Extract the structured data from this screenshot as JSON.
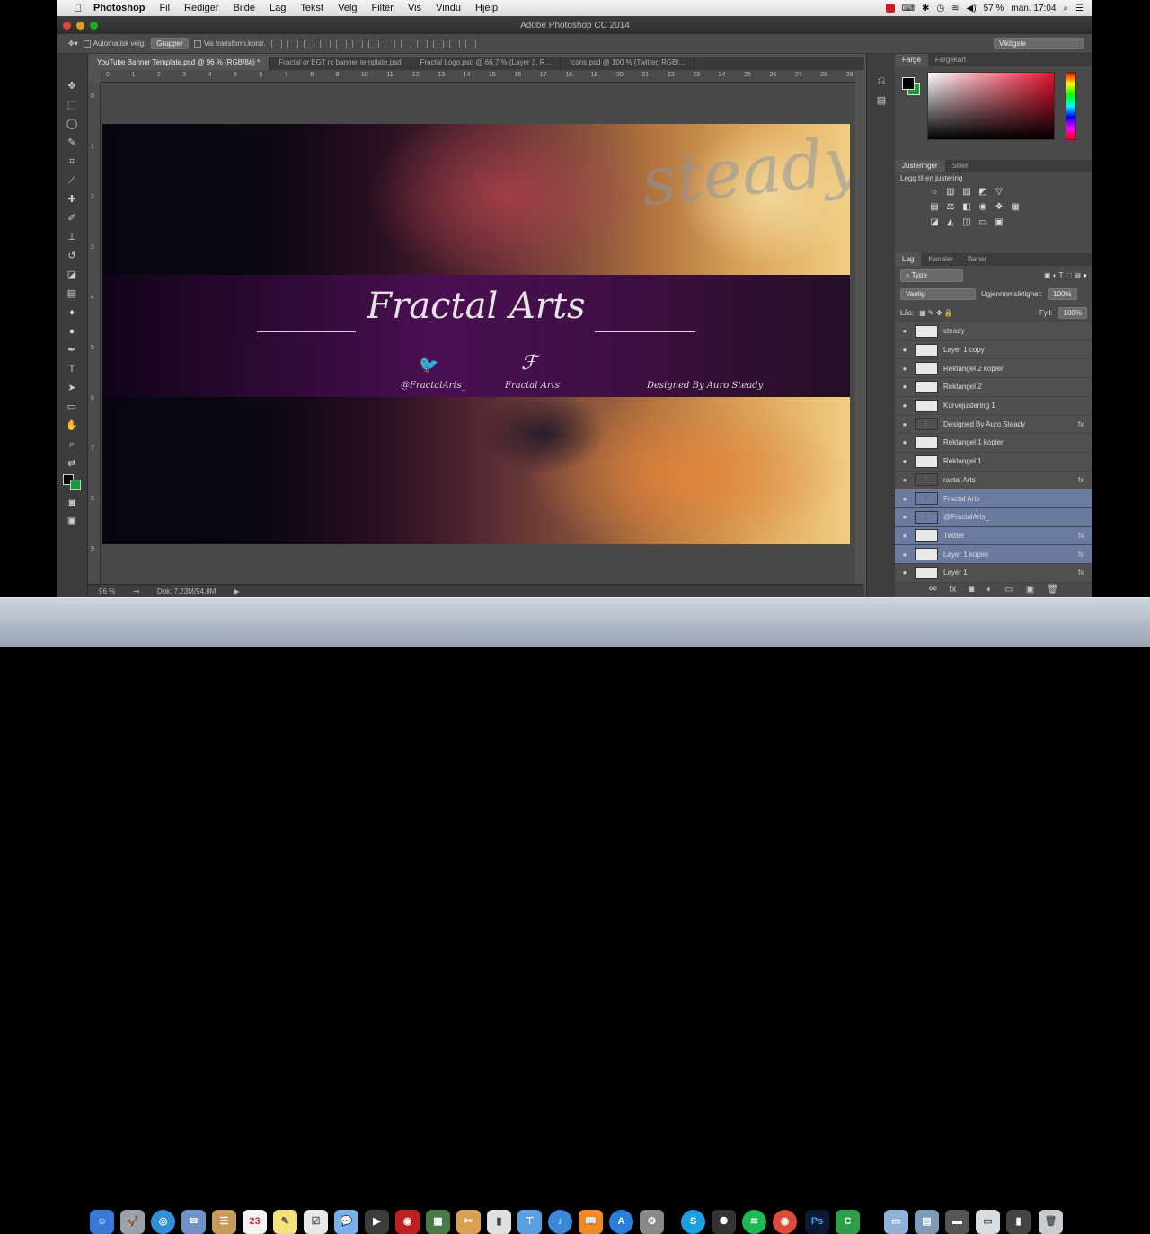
{
  "menubar": {
    "apple": "",
    "app": "Photoshop",
    "items": [
      "Fil",
      "Rediger",
      "Bilde",
      "Lag",
      "Tekst",
      "Velg",
      "Filter",
      "Vis",
      "Vindu",
      "Hjelp"
    ],
    "battery": "57 %",
    "clock": "man. 17:04"
  },
  "window": {
    "title": "Adobe Photoshop CC 2014"
  },
  "options": {
    "auto_select": "Automatisk velg:",
    "group": "Grupper",
    "show_transform": "Vis transform.kontr.",
    "workspace": "Viktigste"
  },
  "doc_tabs": [
    "YouTube Banner Template.psd @ 96 % (RGB/8#) *",
    "Fractal or EGT rc banner template.psd",
    "Fractal Logo.psd @ 66,7 % (Layer 3, R...",
    "Icons.psd @ 100 % (Twitter, RGB/..."
  ],
  "ruler_h": [
    "0",
    "1",
    "2",
    "3",
    "4",
    "5",
    "6",
    "7",
    "8",
    "9",
    "10",
    "11",
    "12",
    "13",
    "14",
    "15",
    "16",
    "17",
    "18",
    "19",
    "20",
    "21",
    "22",
    "23",
    "24",
    "25",
    "26",
    "27",
    "28",
    "29"
  ],
  "ruler_v": [
    "0",
    "1",
    "2",
    "3",
    "4",
    "5",
    "6",
    "7",
    "8",
    "9"
  ],
  "banner": {
    "bg_text": "steady",
    "title": "Fractal Arts",
    "handle": "@FractalArts_",
    "brand": "Fractal Arts",
    "designer": "Designed By Auro Steady",
    "twitter_glyph": "🐦",
    "logo_mark": "ℱ"
  },
  "status": {
    "zoom": "96 %",
    "doc": "Dok: 7,23M/94,8M"
  },
  "panels": {
    "color_tabs": [
      "Farge",
      "Fargekart"
    ],
    "adj_tabs": [
      "Justeringer",
      "Stiler"
    ],
    "adj_title": "Legg til en justering",
    "layer_tabs": [
      "Lag",
      "Kanaler",
      "Baner"
    ],
    "filter": "Type",
    "blend": "Vanlig",
    "opacity_label": "Ugjennomsiktighet:",
    "opacity_value": "100%",
    "lock_label": "Lås:",
    "fill_label": "Fyll:",
    "fill_value": "100%"
  },
  "layers": [
    {
      "name": "steady",
      "thumb": "",
      "fx": "",
      "sel": false
    },
    {
      "name": "Layer 1 copy",
      "thumb": "",
      "fx": "",
      "sel": false
    },
    {
      "name": "Rektangel 2 kopier",
      "thumb": "",
      "fx": "",
      "sel": false
    },
    {
      "name": "Rektangel 2",
      "thumb": "",
      "fx": "",
      "sel": false
    },
    {
      "name": "Kurvejustering 1",
      "thumb": "",
      "fx": "",
      "sel": false
    },
    {
      "name": "Designed By Auro Steady",
      "thumb": "T",
      "fx": "fx",
      "sel": false
    },
    {
      "name": "Rektangel 1 kopier",
      "thumb": "",
      "fx": "",
      "sel": false
    },
    {
      "name": "Rektangel 1",
      "thumb": "",
      "fx": "",
      "sel": false
    },
    {
      "name": "ractal Arts",
      "thumb": "T",
      "fx": "fx",
      "sel": false
    },
    {
      "name": "Fractal Arts",
      "thumb": "T",
      "fx": "",
      "sel": true
    },
    {
      "name": "@FractalArts_",
      "thumb": "T",
      "fx": "",
      "sel": true
    },
    {
      "name": "Twitter",
      "thumb": "",
      "fx": "fx",
      "sel": true
    },
    {
      "name": "Layer 1 kopier",
      "thumb": "",
      "fx": "fx",
      "sel": true
    },
    {
      "name": "Layer 1",
      "thumb": "",
      "fx": "fx",
      "sel": false
    }
  ],
  "dock": {
    "calendar_day": "23",
    "ps_label": "Ps",
    "gc_label": "C"
  },
  "colors": {
    "band": "#4b0f55",
    "selection": "#6a7aa0",
    "fg": "#000000",
    "bg": "#1a9a3a"
  }
}
